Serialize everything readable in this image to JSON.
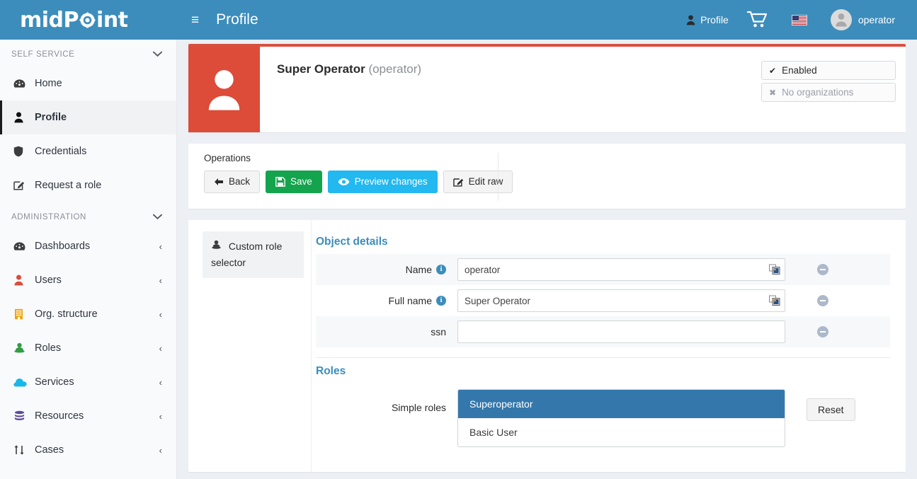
{
  "topbar": {
    "logo_text_1": "mid",
    "logo_text_2": "P",
    "logo_text_3": "int",
    "menu_toggle": "≡",
    "page_title": "Profile",
    "profile_label": "Profile",
    "user_label": "operator",
    "accent_color": "#3c8dbc"
  },
  "sidebar": {
    "sections": [
      {
        "label": "SELF SERVICE",
        "chevron": "❯",
        "items": [
          {
            "label": "Home",
            "icon": "dashboard-icon",
            "active": false,
            "expandable": false
          },
          {
            "label": "Profile",
            "icon": "user-icon",
            "active": true,
            "expandable": false
          },
          {
            "label": "Credentials",
            "icon": "shield-icon",
            "active": false,
            "expandable": false
          },
          {
            "label": "Request a role",
            "icon": "edit-square-icon",
            "active": false,
            "expandable": false
          }
        ]
      },
      {
        "label": "ADMINISTRATION",
        "chevron": "❯",
        "items": [
          {
            "label": "Dashboards",
            "icon": "dashboard-icon",
            "active": false,
            "expandable": true
          },
          {
            "label": "Users",
            "icon": "users-icon",
            "active": false,
            "expandable": true
          },
          {
            "label": "Org. structure",
            "icon": "org-icon",
            "active": false,
            "expandable": true
          },
          {
            "label": "Roles",
            "icon": "roles-icon",
            "active": false,
            "expandable": true
          },
          {
            "label": "Services",
            "icon": "cloud-icon",
            "active": false,
            "expandable": true
          },
          {
            "label": "Resources",
            "icon": "database-icon",
            "active": false,
            "expandable": true
          },
          {
            "label": "Cases",
            "icon": "cases-icon",
            "active": false,
            "expandable": true
          }
        ]
      }
    ],
    "expand_chevron": "‹"
  },
  "summary": {
    "full_name": "Super Operator",
    "username": "(operator)",
    "tags": [
      {
        "icon": "✔",
        "label": "Enabled",
        "muted": false
      },
      {
        "icon": "✖",
        "label": "No organizations",
        "muted": true
      }
    ],
    "accent_color": "#dd4b39"
  },
  "operations": {
    "title": "Operations",
    "buttons": [
      {
        "label": "Back",
        "icon": "arrow-left-icon",
        "style": "default"
      },
      {
        "label": "Save",
        "icon": "floppy-disk-icon",
        "style": "green"
      },
      {
        "label": "Preview changes",
        "icon": "eye-icon",
        "style": "cyan"
      },
      {
        "label": "Edit raw",
        "icon": "edit-square-icon",
        "style": "default"
      }
    ]
  },
  "details": {
    "tab": {
      "label": "Custom role selector",
      "icon": "roles-icon"
    },
    "object_details": {
      "title": "Object details",
      "fields": [
        {
          "label": "Name",
          "has_info": true,
          "value": "operator",
          "placeholder": "",
          "has_localize_icon": true,
          "striped": true
        },
        {
          "label": "Full name",
          "has_info": true,
          "value": "Super Operator",
          "placeholder": "",
          "has_localize_icon": true,
          "striped": false
        },
        {
          "label": "ssn",
          "has_info": false,
          "value": "",
          "placeholder": "",
          "has_localize_icon": false,
          "striped": true
        }
      ]
    },
    "roles": {
      "title": "Roles",
      "field_label": "Simple roles",
      "options": [
        {
          "label": "Superoperator",
          "selected": true
        },
        {
          "label": "Basic User",
          "selected": false
        }
      ],
      "reset_label": "Reset"
    }
  }
}
